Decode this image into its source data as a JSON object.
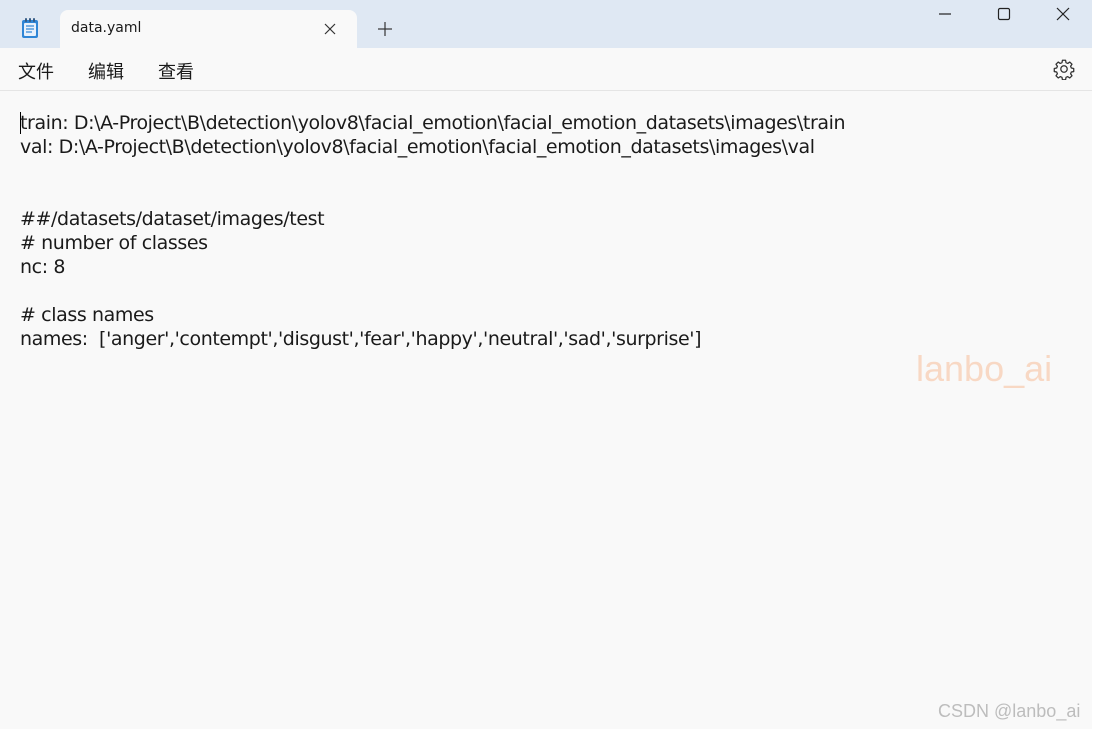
{
  "tab": {
    "title": "data.yaml"
  },
  "menu": {
    "file": "文件",
    "edit": "编辑",
    "view": "查看"
  },
  "editor": {
    "lines": [
      "train: D:\\A-Project\\B\\detection\\yolov8\\facial_emotion\\facial_emotion_datasets\\images\\train",
      "val: D:\\A-Project\\B\\detection\\yolov8\\facial_emotion\\facial_emotion_datasets\\images\\val",
      "",
      "",
      "##/datasets/dataset/images/test",
      "# number of classes",
      "nc: 8",
      "",
      "# class names",
      "names:  ['anger','contempt','disgust','fear','happy','neutral','sad','surprise']"
    ]
  },
  "watermark": "lanbo_ai",
  "footer_mark": "CSDN @lanbo_ai",
  "icons": {
    "app": "notepad-icon",
    "close_tab": "close-icon",
    "new_tab": "plus-icon",
    "minimize": "minimize-icon",
    "maximize": "maximize-icon",
    "close_window": "close-icon",
    "settings": "gear-icon"
  },
  "colors": {
    "titlebar": "#dfe8f3",
    "background": "#f9f9f9",
    "watermark": "#f8d8c4"
  }
}
